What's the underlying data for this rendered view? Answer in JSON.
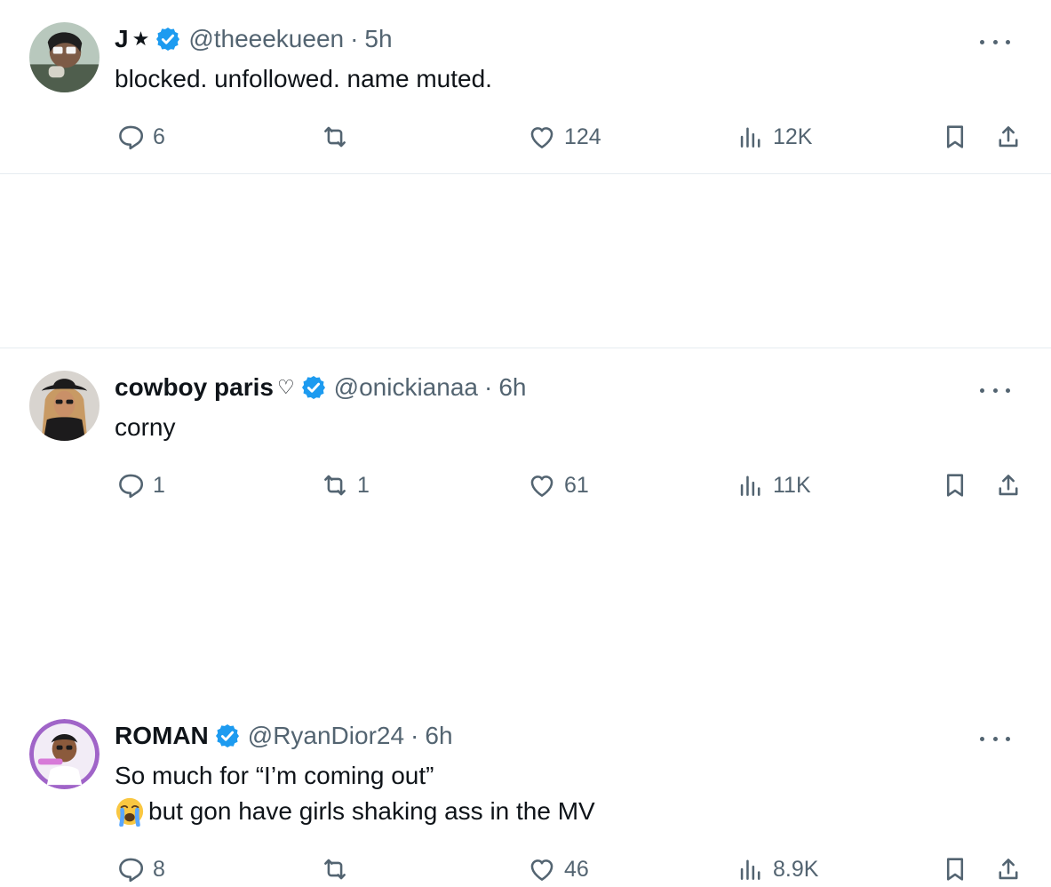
{
  "tweets": [
    {
      "display_name": "J",
      "name_decor": "★",
      "handle": "@theeekueen",
      "dot": "·",
      "time": "5h",
      "body": "blocked. unfollowed. name muted.",
      "reply_count": "6",
      "retweet_count": "",
      "like_count": "124",
      "view_count": "12K",
      "avatar_colors": {
        "bg": "#b8c8bd",
        "accent": "#4f5e4d",
        "face": "#7d5b46"
      }
    },
    {
      "display_name": "cowboy paris",
      "name_decor": "♡",
      "handle": "@onickianaa",
      "dot": "·",
      "time": "6h",
      "body": "corny",
      "reply_count": "1",
      "retweet_count": "1",
      "like_count": "61",
      "view_count": "11K",
      "avatar_colors": {
        "bg": "#d8d4cf",
        "accent": "#1c1b1c",
        "face": "#c89a64"
      }
    },
    {
      "display_name": "ROMAN",
      "name_decor": "",
      "handle": "@RyanDior24",
      "dot": "·",
      "time": "6h",
      "body_line_1": "So much for “I’m coming out”",
      "body_line_2": "but gon have girls shaking ass in the MV",
      "emoji": "😭",
      "reply_count": "8",
      "retweet_count": "",
      "like_count": "46",
      "view_count": "8.9K",
      "avatar_colors": {
        "bg": "#a064c8",
        "accent": "#f2ecf6",
        "face": "#8b5a3c"
      }
    }
  ],
  "colors": {
    "text": "#0f1419",
    "secondary": "#536471",
    "verified": "#1d9bf0",
    "divider": "#e6ecf0"
  },
  "icons": {
    "reply": "reply-icon",
    "retweet": "retweet-icon",
    "like": "heart-icon",
    "views": "views-icon",
    "bookmark": "bookmark-icon",
    "share": "share-icon",
    "verified": "verified-badge-icon",
    "more": "more-icon"
  }
}
